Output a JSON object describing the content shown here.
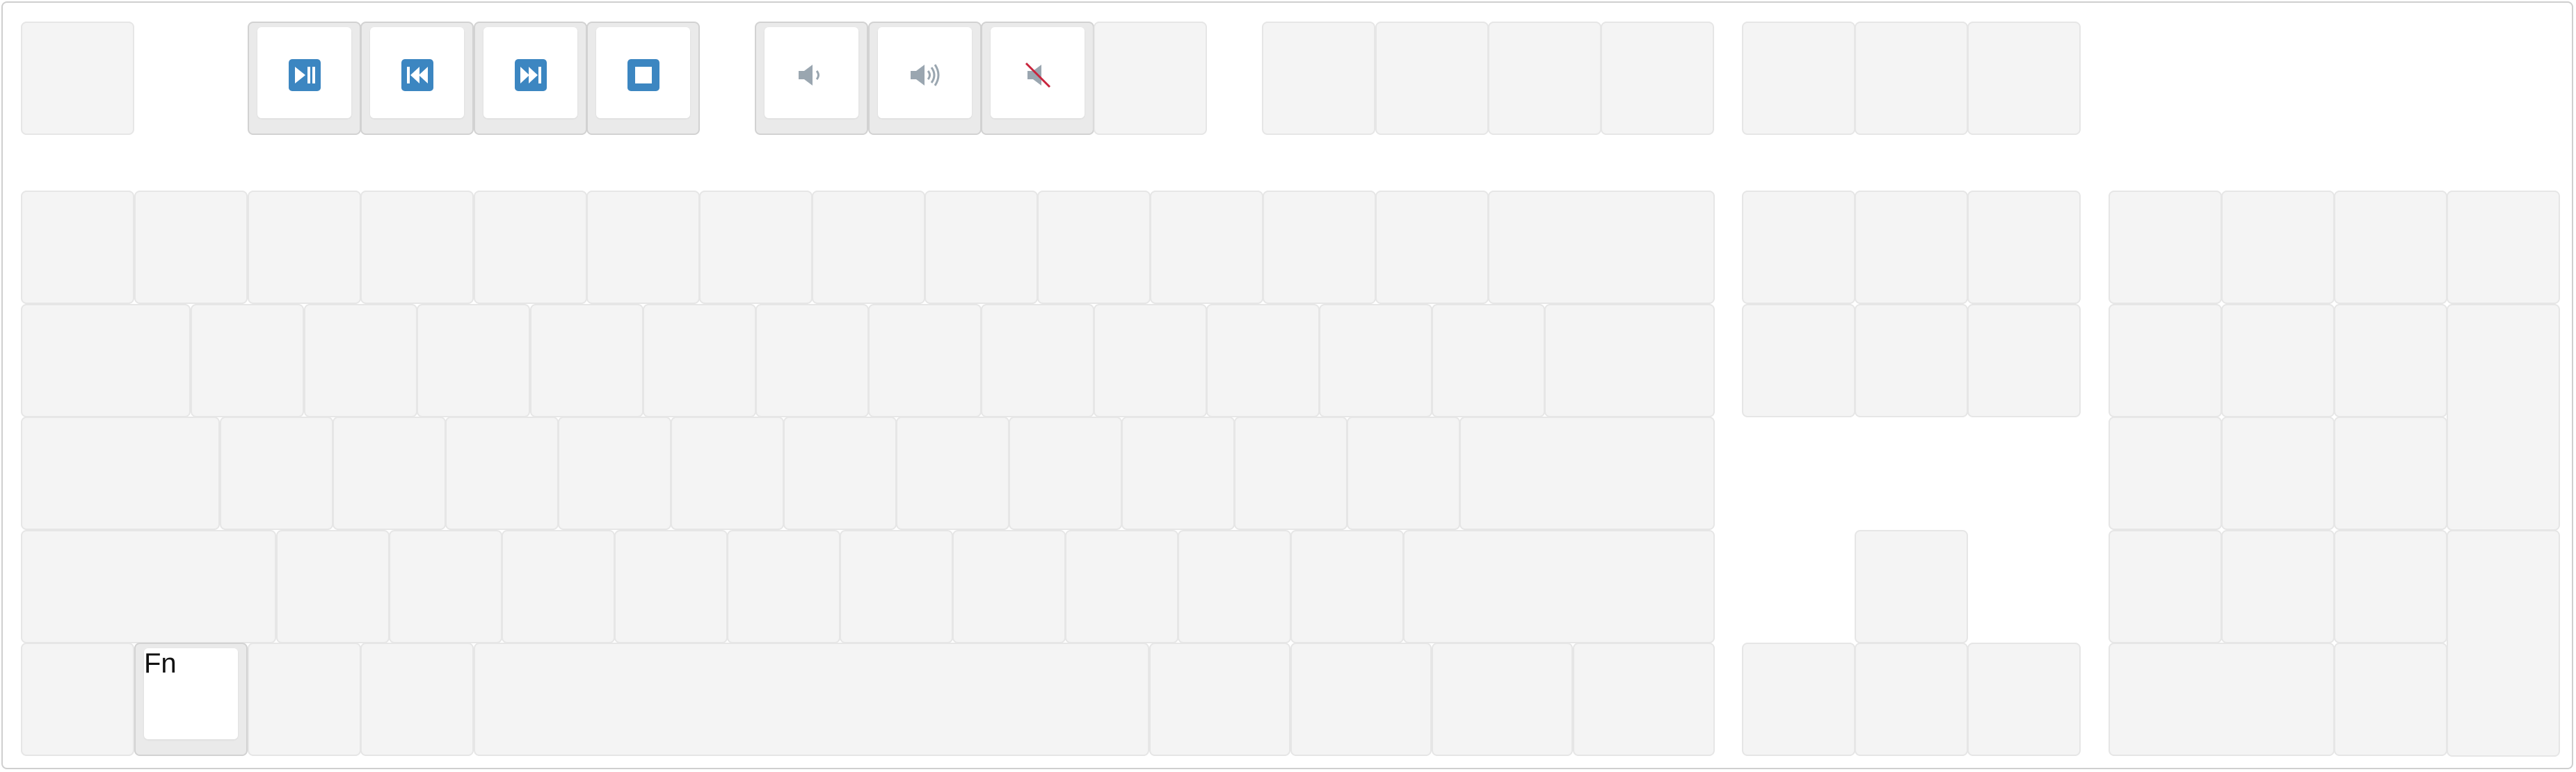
{
  "keyboard": {
    "media_keys": [
      {
        "name": "play-pause",
        "icon": "play-pause-icon"
      },
      {
        "name": "previous-track",
        "icon": "previous-track-icon"
      },
      {
        "name": "next-track",
        "icon": "next-track-icon"
      },
      {
        "name": "stop",
        "icon": "stop-icon"
      },
      {
        "name": "volume-down",
        "icon": "volume-down-icon"
      },
      {
        "name": "volume-up",
        "icon": "volume-up-icon"
      },
      {
        "name": "mute",
        "icon": "mute-icon"
      }
    ],
    "fn_key": {
      "label": "Fn"
    }
  },
  "colors": {
    "icon_blue": "#3c86c1",
    "icon_gray": "#9aa6b0",
    "mute_slash": "#c8243c",
    "key_fill": "#f4f4f4",
    "key_active_fill": "#eaeaea"
  }
}
